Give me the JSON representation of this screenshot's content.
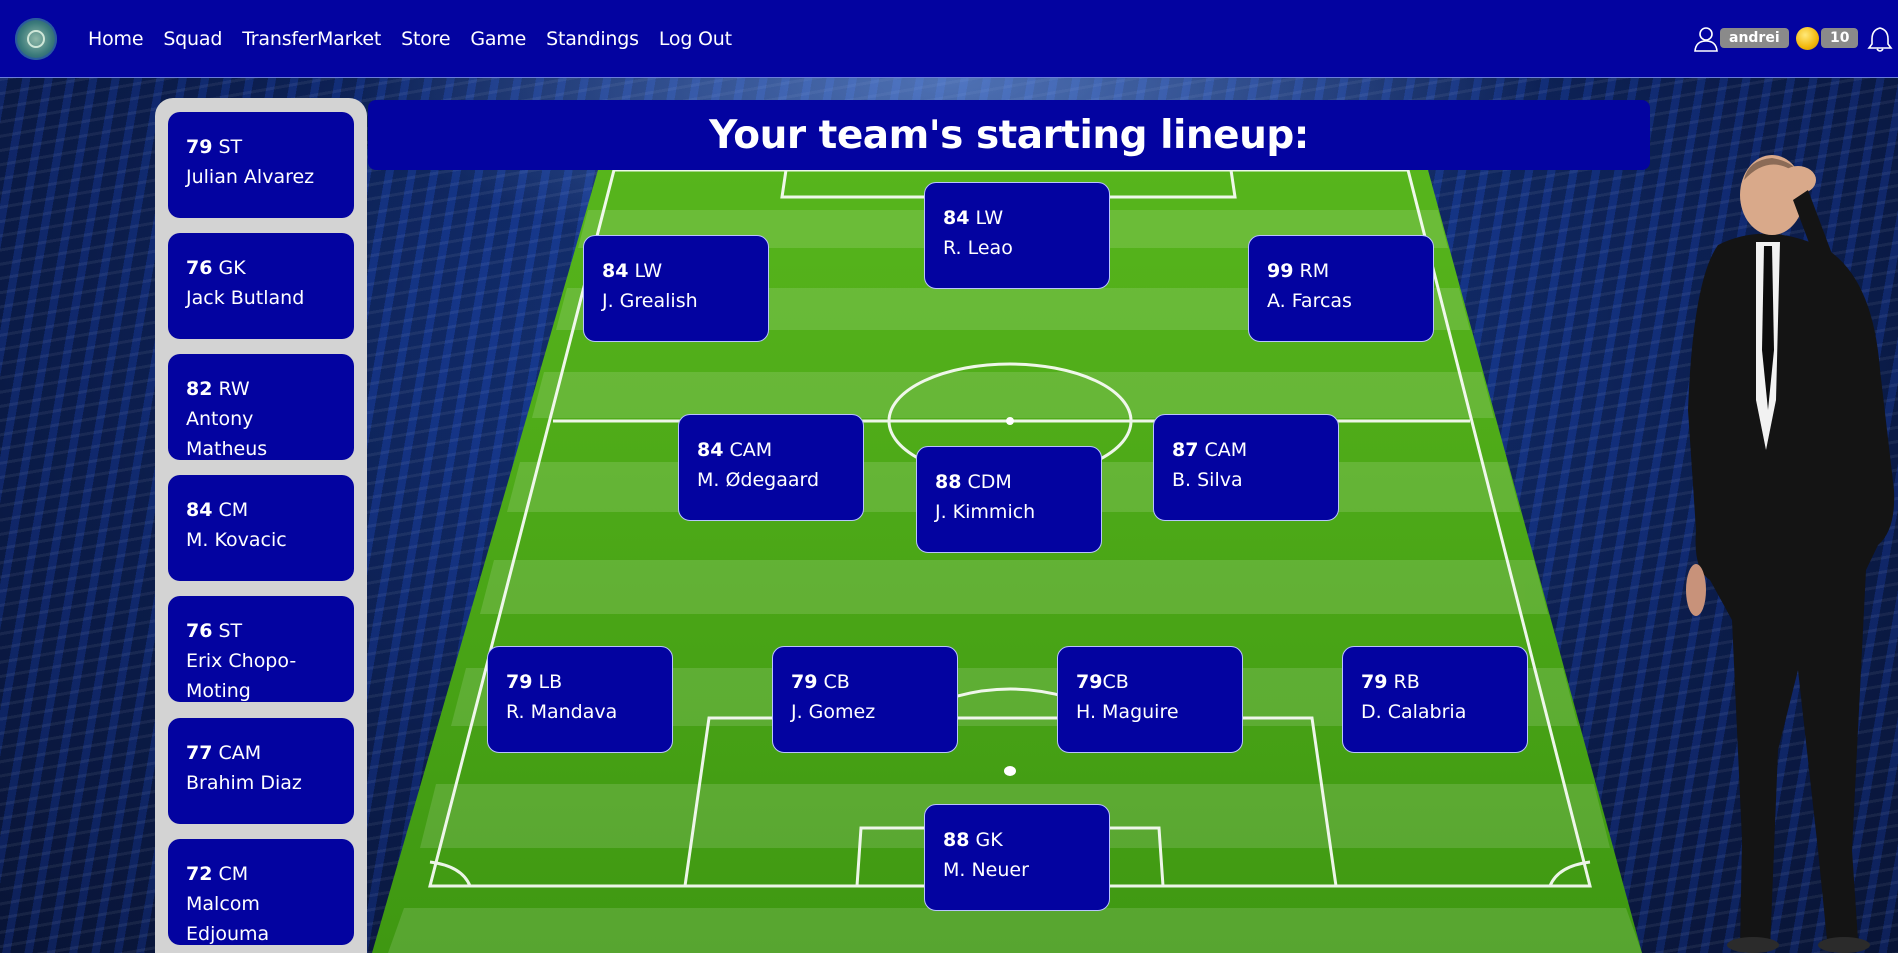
{
  "nav": {
    "links": [
      "Home",
      "Squad",
      "TransferMarket",
      "Store",
      "Game",
      "Standings",
      "Log Out"
    ],
    "username": "andrei",
    "coins": "10"
  },
  "title": "Your team's starting lineup:",
  "subs": [
    {
      "rating": "79",
      "position": "ST",
      "name": "Julian Alvarez"
    },
    {
      "rating": "76",
      "position": "GK",
      "name": "Jack Butland"
    },
    {
      "rating": "82",
      "position": "RW",
      "name": "Antony Matheus"
    },
    {
      "rating": "84",
      "position": "CM",
      "name": "M. Kovacic"
    },
    {
      "rating": "76",
      "position": "ST",
      "name": "Erix Chopo-Moting"
    },
    {
      "rating": "77",
      "position": "CAM",
      "name": "Brahim Diaz"
    },
    {
      "rating": "72",
      "position": "CM",
      "name": "Malcom Edjouma"
    }
  ],
  "lineup": [
    {
      "rating": "84",
      "position": "LW",
      "name": "R. Leao"
    },
    {
      "rating": "84",
      "position": "LW",
      "name": "J. Grealish"
    },
    {
      "rating": "99",
      "position": "RM",
      "name": "A. Farcas"
    },
    {
      "rating": "84",
      "position": "CAM",
      "name": "M. Ødegaard"
    },
    {
      "rating": "88",
      "position": "CDM",
      "name": "J. Kimmich"
    },
    {
      "rating": "87",
      "position": "CAM",
      "name": "B. Silva"
    },
    {
      "rating": "79",
      "position": "LB",
      "name": "R. Mandava"
    },
    {
      "rating": "79",
      "position": "CB",
      "name": "J. Gomez"
    },
    {
      "rating": "79",
      "position": "CB",
      "name": "H. Maguire"
    },
    {
      "rating": "79",
      "position": "RB",
      "name": "D. Calabria"
    },
    {
      "rating": "88",
      "position": "GK",
      "name": "M. Neuer"
    }
  ],
  "colors": {
    "nav_bg": "#0303a0",
    "card_bg": "#0303a0",
    "sidebar_bg": "#d3d3d3",
    "pitch_green": "#4ea81a"
  }
}
